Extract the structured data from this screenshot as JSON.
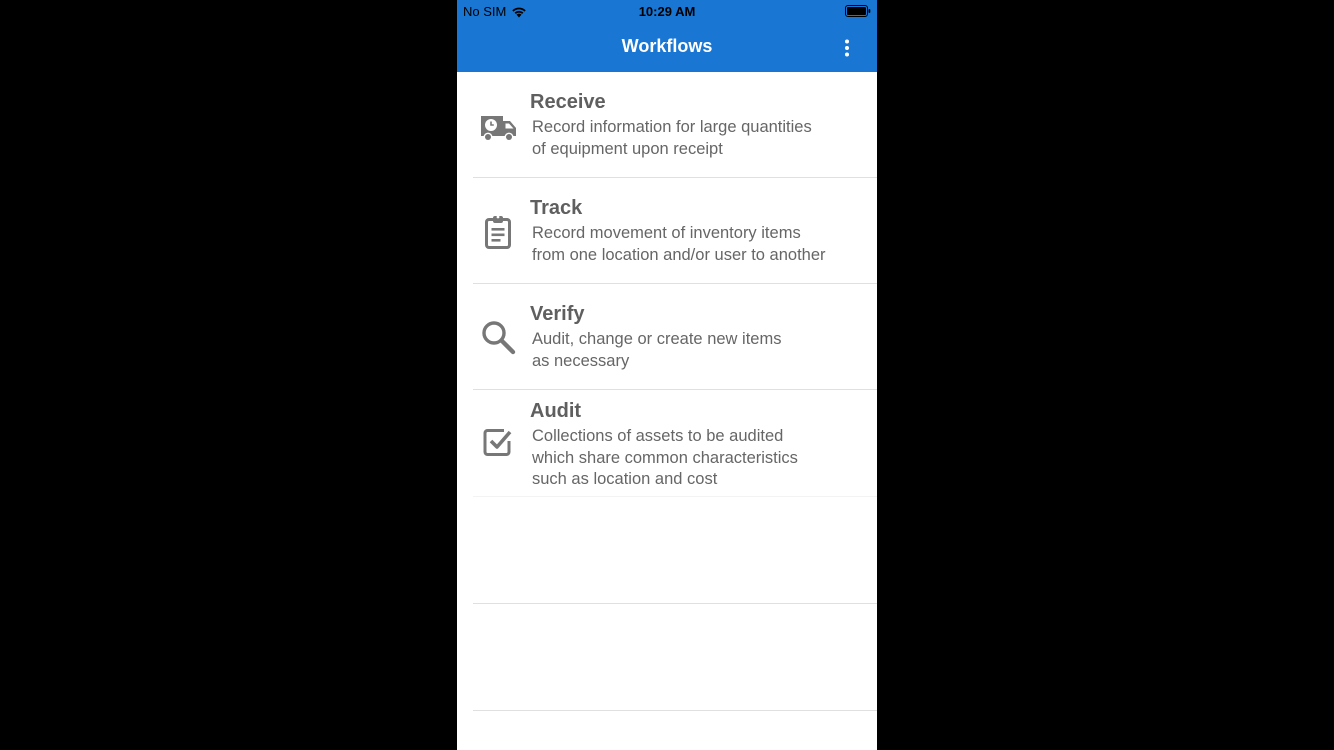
{
  "status_bar": {
    "carrier": "No SIM",
    "time": "10:29 AM"
  },
  "header": {
    "title": "Workflows"
  },
  "colors": {
    "header": "#1976d2",
    "text": "#5f5f5f",
    "icon": "#777777"
  },
  "workflows": [
    {
      "title": "Receive",
      "description_line1": "Record information for large quantities",
      "description_line2": "of equipment upon receipt",
      "icon": "truck-clock-icon"
    },
    {
      "title": "Track",
      "description_line1": "Record movement of inventory items",
      "description_line2": "from one location and/or user to another",
      "icon": "clipboard-icon"
    },
    {
      "title": "Verify",
      "description_line1": "Audit, change or create new items",
      "description_line2": "as necessary",
      "icon": "search-icon"
    },
    {
      "title": "Audit",
      "description_line1": "Collections of assets to be audited",
      "description_line2": "which share common characteristics",
      "description_line3": "such as location and cost",
      "icon": "checkbox-icon"
    }
  ]
}
